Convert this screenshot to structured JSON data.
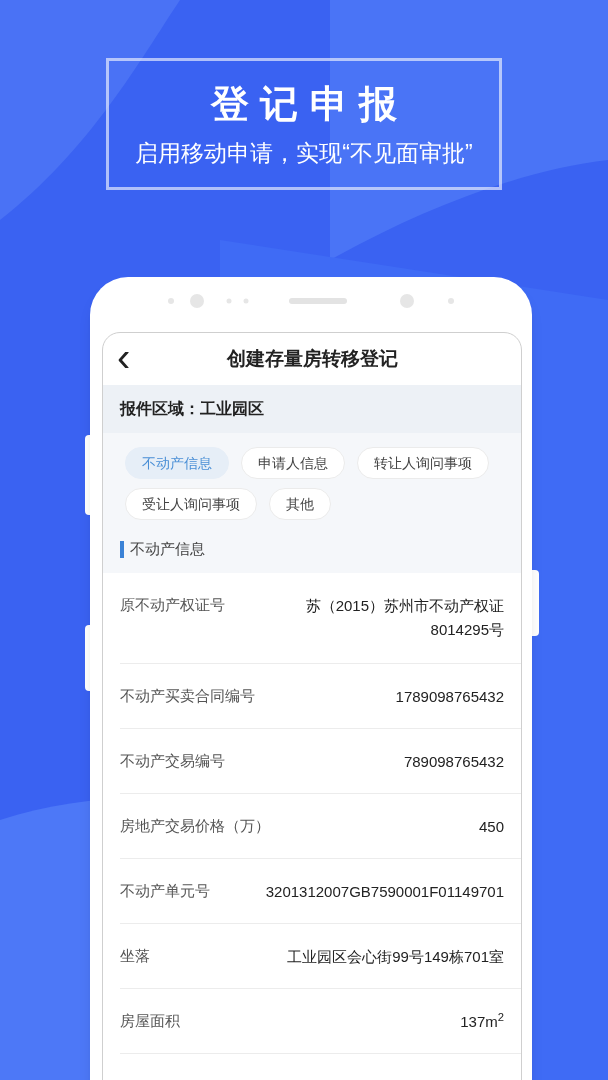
{
  "banner": {
    "title": "登记申报",
    "subtitle": "启用移动申请，实现“不见面审批”"
  },
  "screen": {
    "back": "‹",
    "title": "创建存量房转移登记",
    "region": "报件区域：工业园区",
    "tabs": [
      {
        "label": "不动产信息",
        "selected": true
      },
      {
        "label": "申请人信息",
        "selected": false
      },
      {
        "label": "转让人询问事项",
        "selected": false
      },
      {
        "label": "受让人询问事项",
        "selected": false
      },
      {
        "label": "其他",
        "selected": false
      }
    ],
    "section_title": "不动产信息",
    "rows": [
      {
        "label": "原不动产权证号",
        "value": "苏（2015）苏州市不动产权证8014295号"
      },
      {
        "label": "不动产买卖合同编号",
        "value": "1789098765432"
      },
      {
        "label": "不动产交易编号",
        "value": "789098765432"
      },
      {
        "label": "房地产交易价格（万）",
        "value": "450"
      },
      {
        "label": "不动产单元号",
        "value": "3201312007GB7590001F01149701"
      },
      {
        "label": "坐落",
        "value": "工业园区会心街99号149栋701室"
      },
      {
        "label": "房屋面积",
        "value": "137m$^{2}$"
      }
    ]
  }
}
